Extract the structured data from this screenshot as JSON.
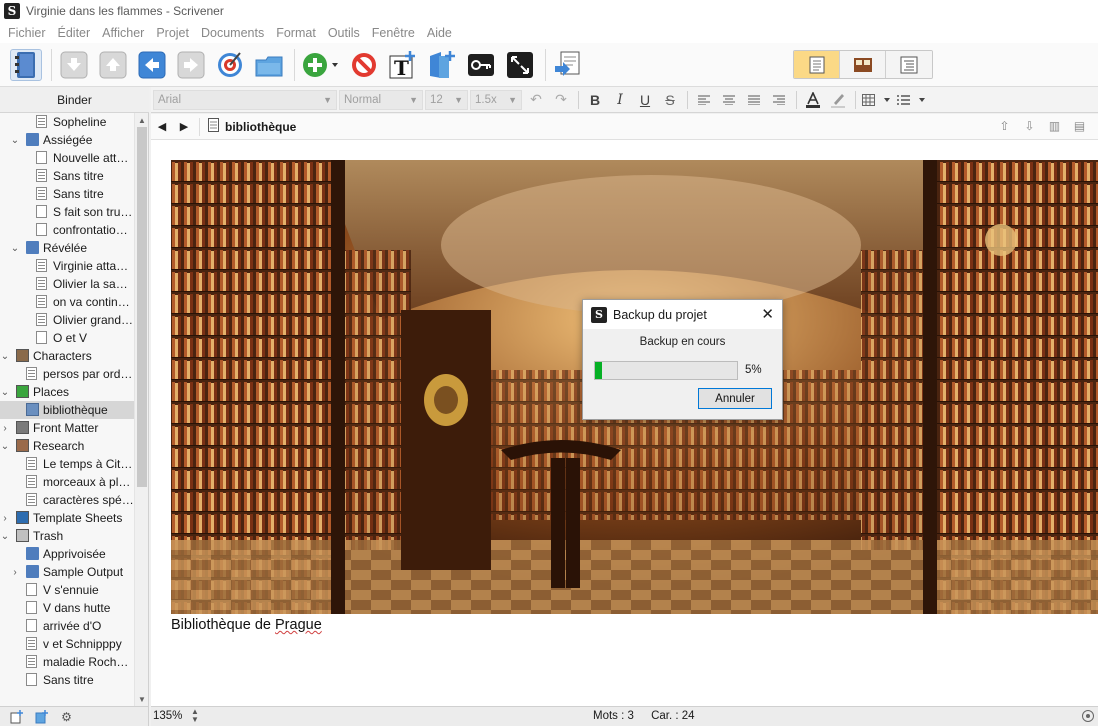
{
  "window": {
    "title": "Virginie dans les flammes - Scrivener"
  },
  "menu": [
    "Fichier",
    "Éditer",
    "Afficher",
    "Projet",
    "Documents",
    "Format",
    "Outils",
    "Fenêtre",
    "Aide"
  ],
  "toolbar": {
    "buttons": [
      "binder-icon",
      "move-down-icon",
      "move-up-icon",
      "move-left-icon",
      "move-right-icon",
      "target-icon",
      "inspector-icon",
      "add-icon",
      "delete-icon",
      "new-text-icon",
      "new-folder-icon",
      "keyword-icon",
      "fullscreen-icon",
      "compile-icon"
    ],
    "view_modes": [
      "document-view-icon",
      "corkboard-view-icon",
      "outline-view-icon"
    ],
    "active_view": 0
  },
  "binder": {
    "header": "Binder",
    "items": [
      {
        "label": "Sopheline",
        "level": 2,
        "icon": "text",
        "expander": ""
      },
      {
        "label": "Assiégée",
        "level": 1,
        "icon": "folder",
        "expander": "down"
      },
      {
        "label": "Nouvelle attaq...",
        "level": 2,
        "icon": "doc",
        "expander": ""
      },
      {
        "label": "Sans titre",
        "level": 2,
        "icon": "text",
        "expander": ""
      },
      {
        "label": "Sans titre",
        "level": 2,
        "icon": "text",
        "expander": ""
      },
      {
        "label": "S fait son truc ...",
        "level": 2,
        "icon": "doc",
        "expander": ""
      },
      {
        "label": "confrontation ...",
        "level": 2,
        "icon": "doc",
        "expander": ""
      },
      {
        "label": "Révélée",
        "level": 1,
        "icon": "folder",
        "expander": "down"
      },
      {
        "label": "Virginie attaquée",
        "level": 2,
        "icon": "text",
        "expander": ""
      },
      {
        "label": "Olivier la sauve",
        "level": 2,
        "icon": "text",
        "expander": ""
      },
      {
        "label": "on va continue...",
        "level": 2,
        "icon": "text",
        "expander": ""
      },
      {
        "label": "Olivier grand D...",
        "level": 2,
        "icon": "text",
        "expander": ""
      },
      {
        "label": "O et V",
        "level": 2,
        "icon": "doc",
        "expander": ""
      },
      {
        "label": "Characters",
        "level": 0,
        "icon": "characters",
        "expander": "down"
      },
      {
        "label": "persos par ordre...",
        "level": 1,
        "icon": "text",
        "expander": ""
      },
      {
        "label": "Places",
        "level": 0,
        "icon": "places",
        "expander": "down"
      },
      {
        "label": "bibliothèque",
        "level": 1,
        "icon": "img",
        "expander": "",
        "selected": true
      },
      {
        "label": "Front Matter",
        "level": 0,
        "icon": "frontmatter",
        "expander": "right"
      },
      {
        "label": "Research",
        "level": 0,
        "icon": "research",
        "expander": "down"
      },
      {
        "label": "Le temps à Citara",
        "level": 1,
        "icon": "text",
        "expander": ""
      },
      {
        "label": "morceaux à plac...",
        "level": 1,
        "icon": "text",
        "expander": ""
      },
      {
        "label": "caractères spéci...",
        "level": 1,
        "icon": "text",
        "expander": ""
      },
      {
        "label": "Template Sheets",
        "level": 0,
        "icon": "template",
        "expander": "right"
      },
      {
        "label": "Trash",
        "level": 0,
        "icon": "trash",
        "expander": "down"
      },
      {
        "label": "Apprivoisée",
        "level": 1,
        "icon": "folder",
        "expander": ""
      },
      {
        "label": "Sample Output",
        "level": 1,
        "icon": "folder",
        "expander": "right"
      },
      {
        "label": "V s'ennuie",
        "level": 1,
        "icon": "doc",
        "expander": ""
      },
      {
        "label": "V dans hutte",
        "level": 1,
        "icon": "doc",
        "expander": ""
      },
      {
        "label": "arrivée d'O",
        "level": 1,
        "icon": "doc",
        "expander": ""
      },
      {
        "label": "v et Schnipppy",
        "level": 1,
        "icon": "text",
        "expander": ""
      },
      {
        "label": "maladie Rochela...",
        "level": 1,
        "icon": "text",
        "expander": ""
      },
      {
        "label": "Sans titre",
        "level": 1,
        "icon": "doc",
        "expander": ""
      }
    ]
  },
  "format_bar": {
    "font": "Arial",
    "style": "Normal",
    "size": "12",
    "spacing": "1.5x"
  },
  "editor": {
    "doc_title": "bibliothèque",
    "caption_pre": "Bibliothèque de ",
    "caption_word": "Prague"
  },
  "dialog": {
    "title": "Backup du projet",
    "message": "Backup en cours",
    "progress": 0.05,
    "percent_label": "5%",
    "cancel_label": "Annuler"
  },
  "footer": {
    "zoom": "135%",
    "words": "Mots : 3",
    "chars": "Car. : 24"
  },
  "colors": {
    "accent": "#fbd986",
    "progress": "#06b025",
    "button_focus": "#0078d7"
  }
}
